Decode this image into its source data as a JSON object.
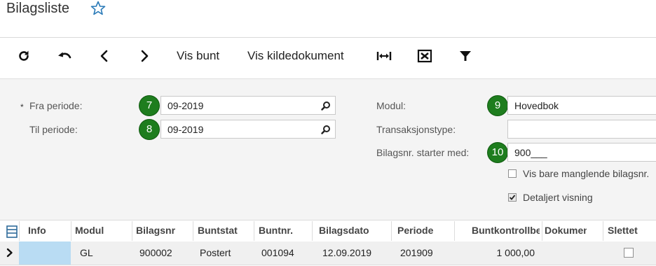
{
  "header": {
    "title": "Bilagsliste",
    "favorite_icon": "star-outline-icon"
  },
  "toolbar": {
    "refresh_icon": "refresh-icon",
    "undo_icon": "undo-icon",
    "prev_icon": "chevron-left-icon",
    "next_icon": "chevron-right-icon",
    "vis_bunt": "Vis bunt",
    "vis_kildedokument": "Vis kildedokument",
    "fit_icon": "fit-columns-icon",
    "excel_icon": "export-excel-icon",
    "filter_icon": "filter-icon"
  },
  "form": {
    "required_mark": "*",
    "fra_periode": {
      "label": "Fra periode:",
      "value": "09-2019",
      "badge": "7"
    },
    "til_periode": {
      "label": "Til periode:",
      "value": "09-2019",
      "badge": "8"
    },
    "modul": {
      "label": "Modul:",
      "value": "Hovedbok",
      "badge": "9"
    },
    "transaksjonstype": {
      "label": "Transaksjonstype:",
      "value": ""
    },
    "bilagsnr_starter": {
      "label": "Bilagsnr. starter med:",
      "value": "900___",
      "badge": "10"
    },
    "vis_bare_manglende": {
      "label": "Vis bare manglende bilagsnr.",
      "checked": false
    },
    "detaljert_visning": {
      "label": "Detaljert visning",
      "checked": true
    }
  },
  "grid": {
    "columns": [
      "Info",
      "Modul",
      "Bilagsnr",
      "Buntstatus",
      "Buntnr.",
      "Bilagsdato",
      "Periode",
      "Buntkontrollbeløp",
      "Dokument",
      "Slettet"
    ],
    "rows": [
      {
        "info": "",
        "modul": "GL",
        "bilagsnr": "900002",
        "buntstatus": "Postert",
        "buntnr": "001094",
        "bilagsdato": "12.09.2019",
        "periode": "201909",
        "buntkontrollbelop": "1 000,00",
        "dokument": "",
        "slettet": false
      }
    ]
  },
  "colors": {
    "badge": "#1e7d1e",
    "selected_cell": "#b9dcf3",
    "accent_star": "#2a7ab8"
  }
}
